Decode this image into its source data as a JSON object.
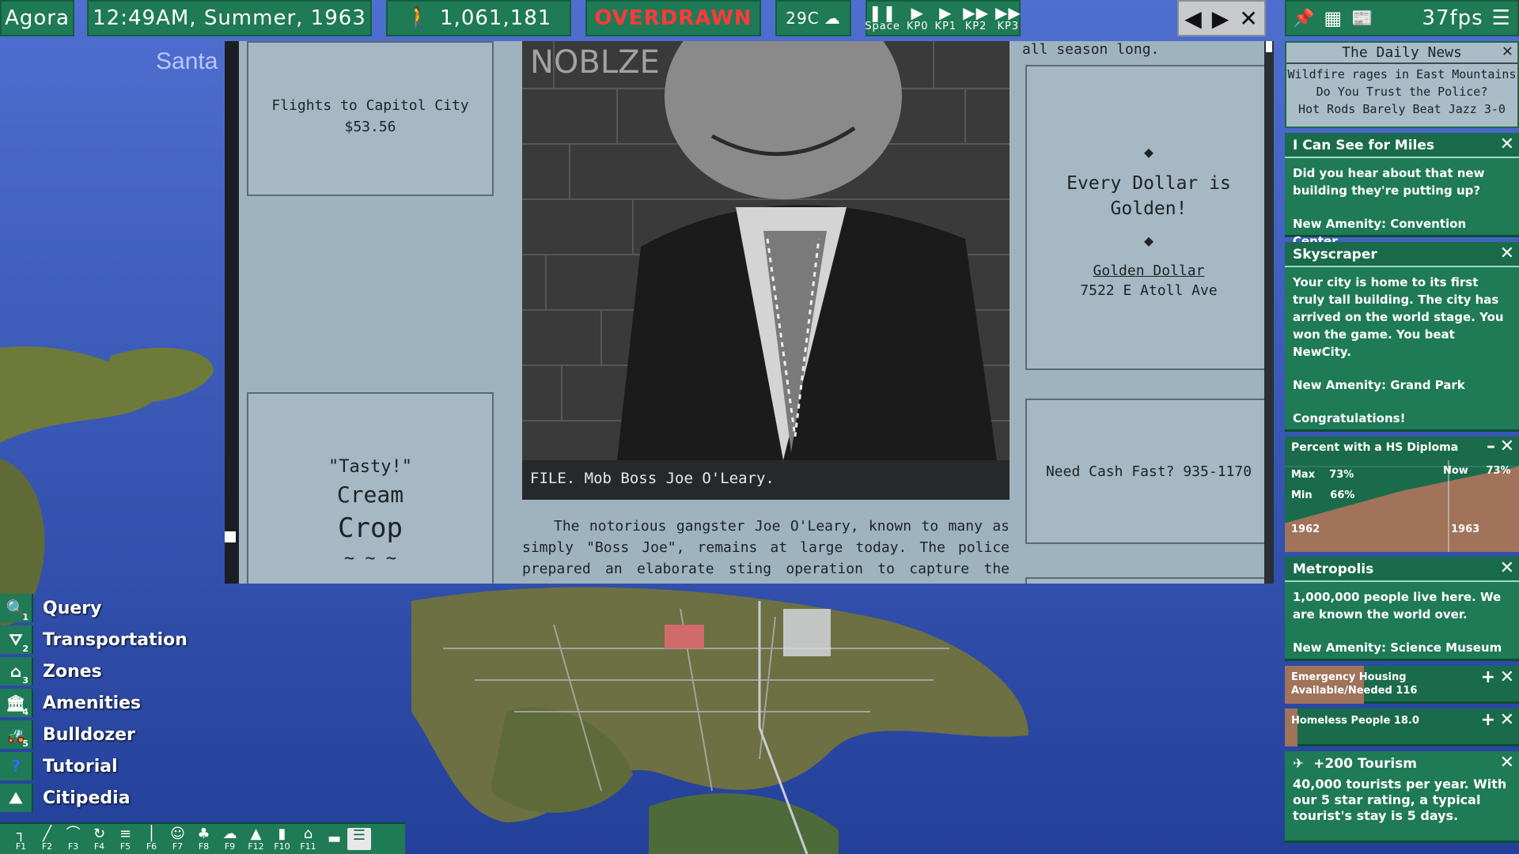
{
  "topbar": {
    "city": "Agora",
    "datetime": "12:49AM,  Summer,  1963",
    "population": "1,061,181",
    "finance_status": "OVERDRAWN",
    "temperature": "29C",
    "speed_controls": [
      {
        "icon": "pause-icon",
        "key": "Space"
      },
      {
        "icon": "play-slow-icon",
        "key": "KP0"
      },
      {
        "icon": "play-icon",
        "key": "KP1"
      },
      {
        "icon": "fast-forward-icon",
        "key": "KP2"
      },
      {
        "icon": "fastest-icon",
        "key": "KP3"
      }
    ],
    "fps": "37fps"
  },
  "map_label": "Santa",
  "newspaper": {
    "ad_flights": {
      "line1": "Flights to Capitol City",
      "line2": "$53.56"
    },
    "season_text": "all season long.",
    "ad_golden": {
      "headline": "Every Dollar is Golden!",
      "name": "Golden Dollar",
      "address": "7522 E Atoll Ave"
    },
    "ad_cream": {
      "quote": "\"Tasty!\"",
      "line1": "Cream",
      "line2": "Crop",
      "decor": "~ ~ ~"
    },
    "ad_cash": {
      "text": "Need Cash Fast? 935-1170"
    },
    "caption": "FILE. Mob Boss Joe O'Leary.",
    "article": "The notorious gangster Joe O'Leary, known to many as simply \"Boss Joe\", remains at large today. The police prepared an elaborate sting operation to capture the famous criminal, but Boss Joe was tipped off and fled justice yesterday. City officials speculate that there may"
  },
  "daily_news": {
    "title": "The Daily News",
    "headlines": [
      "Wildfire rages in East Mountains",
      "Do You Trust the Police?",
      "Hot Rods Barely Beat Jazz 3-0"
    ]
  },
  "notifications": [
    {
      "title": "I Can See for Miles",
      "body": "Did you hear about that new building they're putting up?",
      "amenity": "New Amenity: Convention Center"
    },
    {
      "title": "Skyscraper",
      "body": "Your city is home to its first truly tall building. The city has arrived on the world stage. You won the game. You beat NewCity.",
      "amenity": "New Amenity: Grand Park",
      "extra": "Congratulations!"
    },
    {
      "title": "Metropolis",
      "body": "1,000,000 people live here. We are known the world over.",
      "amenity": "New Amenity: Science Museum"
    }
  ],
  "diploma_chart": {
    "title": "Percent with a HS Diploma",
    "max_label": "Max",
    "max_value": "73%",
    "min_label": "Min",
    "min_value": "66%",
    "now_label": "Now",
    "now_value": "73%",
    "year_start": "1962",
    "year_end": "1963"
  },
  "chart_data": {
    "type": "area",
    "title": "Percent with a HS Diploma",
    "x": [
      "1962",
      "1962.5",
      "1963"
    ],
    "values": [
      66,
      70,
      73
    ],
    "ylim": [
      66,
      73
    ]
  },
  "housing": {
    "line1": "Emergency Housing",
    "line2": "Available/Needed  116"
  },
  "homeless": {
    "text": "Homeless People 18.0"
  },
  "tourism": {
    "title": "+200 Tourism",
    "body": "40,000 tourists per year. With our 5 star rating, a typical tourist's stay is 5 days."
  },
  "menu": [
    {
      "label": "Query",
      "key": "1",
      "icon": "magnifier-icon",
      "glyph": "🔍"
    },
    {
      "label": "Transportation",
      "key": "2",
      "icon": "road-icon",
      "glyph": "⛛"
    },
    {
      "label": "Zones",
      "key": "3",
      "icon": "house-icon",
      "glyph": "⌂"
    },
    {
      "label": "Amenities",
      "key": "4",
      "icon": "museum-icon",
      "glyph": "🏛"
    },
    {
      "label": "Bulldozer",
      "key": "5",
      "icon": "bulldozer-icon",
      "glyph": "🚜"
    },
    {
      "label": "Tutorial",
      "key": "",
      "icon": "question-icon",
      "glyph": "?"
    },
    {
      "label": "Citipedia",
      "key": "",
      "icon": "book-icon",
      "glyph": "⛰"
    }
  ],
  "fkeys": [
    "F1",
    "F2",
    "F3",
    "F4",
    "F5",
    "F6",
    "F7",
    "F8",
    "F9",
    "F12",
    "F10",
    "F11"
  ]
}
